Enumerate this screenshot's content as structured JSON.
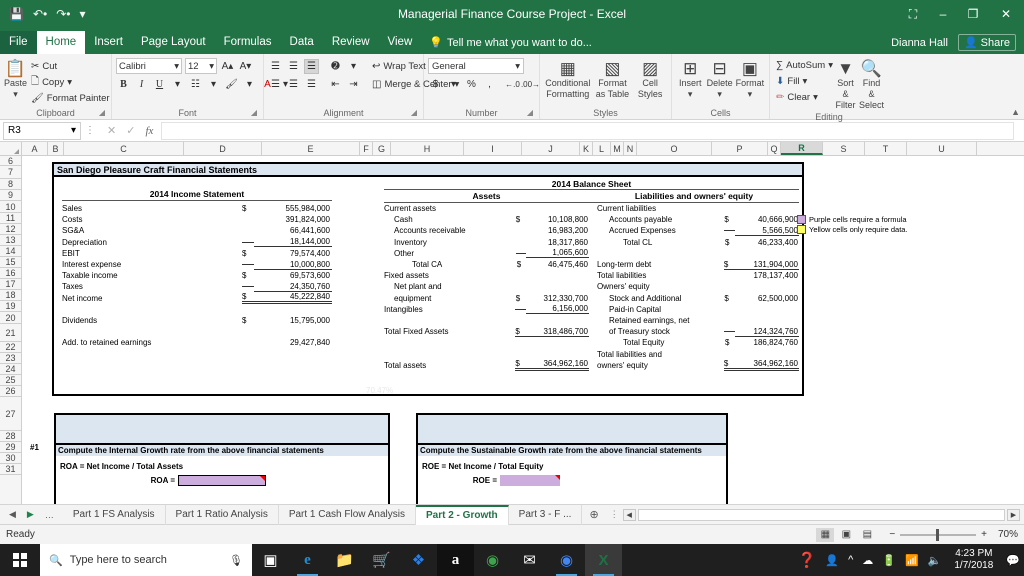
{
  "titlebar": {
    "save_icon": "save-icon",
    "undo_icon": "undo-icon",
    "redo_icon": "redo-icon",
    "qat_more_icon": "qat-dropdown-icon",
    "title": "Managerial Finance Course Project - Excel",
    "ribbon_display_icon": "ribbon-display-options-icon",
    "minimize": "–",
    "restore": "❐",
    "close": "✕"
  },
  "ribbon_tabs": [
    {
      "label": "File",
      "active": false
    },
    {
      "label": "Home",
      "active": true
    },
    {
      "label": "Insert",
      "active": false
    },
    {
      "label": "Page Layout",
      "active": false
    },
    {
      "label": "Formulas",
      "active": false
    },
    {
      "label": "Data",
      "active": false
    },
    {
      "label": "Review",
      "active": false
    },
    {
      "label": "View",
      "active": false
    }
  ],
  "tellme": "Tell me what you want to do...",
  "user": {
    "name": "Dianna Hall",
    "share_label": "Share"
  },
  "ribbon": {
    "clipboard": {
      "label": "Clipboard",
      "paste": "Paste",
      "cut": "Cut",
      "copy": "Copy",
      "format_painter": "Format Painter"
    },
    "font": {
      "label": "Font",
      "font_name": "Calibri",
      "font_size": "12",
      "grow": "A",
      "shrink": "A",
      "bold": "B",
      "italic": "I",
      "underline": "U"
    },
    "alignment": {
      "label": "Alignment",
      "wrap_text": "Wrap Text",
      "merge_center": "Merge & Center"
    },
    "number": {
      "label": "Number",
      "format": "General",
      "currency": "$",
      "percent": "%",
      "comma": ","
    },
    "styles": {
      "label": "Styles",
      "conditional_formatting": "Conditional Formatting",
      "format_as_table": "Format as Table",
      "cell_styles": "Cell Styles"
    },
    "cells": {
      "label": "Cells",
      "insert": "Insert",
      "delete": "Delete",
      "format": "Format"
    },
    "editing": {
      "label": "Editing",
      "autosum": "AutoSum",
      "fill": "Fill",
      "clear": "Clear",
      "sort_filter": "Sort & Filter",
      "find_select": "Find & Select"
    }
  },
  "formula_bar": {
    "name_box": "R3",
    "cancel_icon": "cancel-icon",
    "enter_icon": "enter-icon",
    "fx_icon": "insert-function-icon",
    "formula_value": ""
  },
  "grid": {
    "columns": [
      {
        "label": "A",
        "w": 26,
        "sel": false
      },
      {
        "label": "B",
        "w": 16,
        "sel": false
      },
      {
        "label": "C",
        "w": 120,
        "sel": false
      },
      {
        "label": "D",
        "w": 78,
        "sel": false
      },
      {
        "label": "E",
        "w": 98,
        "sel": false
      },
      {
        "label": "F",
        "w": 13,
        "sel": false
      },
      {
        "label": "G",
        "w": 18,
        "sel": false
      },
      {
        "label": "H",
        "w": 73,
        "sel": false
      },
      {
        "label": "I",
        "w": 58,
        "sel": false
      },
      {
        "label": "J",
        "w": 58,
        "sel": false
      },
      {
        "label": "K",
        "w": 13,
        "sel": false
      },
      {
        "label": "L",
        "w": 18,
        "sel": false
      },
      {
        "label": "M",
        "w": 13,
        "sel": false
      },
      {
        "label": "N",
        "w": 13,
        "sel": false
      },
      {
        "label": "O",
        "w": 75,
        "sel": false
      },
      {
        "label": "P",
        "w": 56,
        "sel": false
      },
      {
        "label": "Q",
        "w": 13,
        "sel": false
      },
      {
        "label": "R",
        "w": 42,
        "sel": true
      },
      {
        "label": "S",
        "w": 42,
        "sel": false
      },
      {
        "label": "T",
        "w": 42,
        "sel": false
      },
      {
        "label": "U",
        "w": 70,
        "sel": false
      }
    ],
    "rows": [
      {
        "label": "6",
        "h": 10
      },
      {
        "label": "7",
        "h": 13
      },
      {
        "label": "8",
        "h": 11
      },
      {
        "label": "9",
        "h": 11
      },
      {
        "label": "10",
        "h": 12
      },
      {
        "label": "11",
        "h": 11
      },
      {
        "label": "12",
        "h": 11
      },
      {
        "label": "13",
        "h": 11
      },
      {
        "label": "14",
        "h": 11
      },
      {
        "label": "15",
        "h": 11
      },
      {
        "label": "16",
        "h": 11
      },
      {
        "label": "17",
        "h": 11
      },
      {
        "label": "18",
        "h": 11
      },
      {
        "label": "19",
        "h": 11
      },
      {
        "label": "20",
        "h": 12
      },
      {
        "label": "21",
        "h": 18
      },
      {
        "label": "22",
        "h": 11
      },
      {
        "label": "23",
        "h": 11
      },
      {
        "label": "24",
        "h": 11
      },
      {
        "label": "25",
        "h": 11
      },
      {
        "label": "26",
        "h": 11
      },
      {
        "label": "27",
        "h": 34
      },
      {
        "label": "28",
        "h": 11
      },
      {
        "label": "29",
        "h": 11
      },
      {
        "label": "30",
        "h": 11
      },
      {
        "label": "31",
        "h": 11
      }
    ]
  },
  "sheet": {
    "card_title": "San Diego Pleasure Craft Financial Statements",
    "income_statement": {
      "title": "2014 Income Statement",
      "rows": [
        {
          "label": "Sales",
          "cur": "$",
          "value": "555,984,000",
          "style": ""
        },
        {
          "label": "Costs",
          "cur": "",
          "value": "391,824,000",
          "style": ""
        },
        {
          "label": "SG&A",
          "cur": "",
          "value": "66,441,600",
          "style": ""
        },
        {
          "label": "Depreciation",
          "cur": "",
          "value": "18,144,000",
          "style": "u"
        },
        {
          "label": "EBIT",
          "cur": "$",
          "value": "79,574,400",
          "style": ""
        },
        {
          "label": "Interest expense",
          "cur": "",
          "value": "10,000,800",
          "style": "u"
        },
        {
          "label": "Taxable income",
          "cur": "$",
          "value": "69,573,600",
          "style": ""
        },
        {
          "label": "Taxes",
          "cur": "",
          "value": "24,350,760",
          "style": "u"
        },
        {
          "label": "Net income",
          "cur": "$",
          "value": "45,222,840",
          "style": "dbl"
        },
        {
          "label": "",
          "cur": "",
          "value": "",
          "style": ""
        },
        {
          "label": "Dividends",
          "cur": "$",
          "value": "15,795,000",
          "style": ""
        },
        {
          "label": "",
          "cur": "",
          "value": "",
          "style": ""
        },
        {
          "label": "Add. to retained earnings",
          "cur": "",
          "value": "29,427,840",
          "style": ""
        }
      ]
    },
    "balance_sheet": {
      "title": "2014 Balance Sheet",
      "assets_header": "Assets",
      "liabilities_header": "Liabilities and owners' equity",
      "assets": [
        {
          "label": "Current assets",
          "cur": "",
          "value": "",
          "indent": 0,
          "style": ""
        },
        {
          "label": "Cash",
          "cur": "$",
          "value": "10,108,800",
          "indent": 1,
          "style": ""
        },
        {
          "label": "Accounts receivable",
          "cur": "",
          "value": "16,983,200",
          "indent": 1,
          "style": ""
        },
        {
          "label": "Inventory",
          "cur": "",
          "value": "18,317,860",
          "indent": 1,
          "style": ""
        },
        {
          "label": "Other",
          "cur": "",
          "value": "1,065,600",
          "indent": 1,
          "style": "u"
        },
        {
          "label": "Total CA",
          "cur": "$",
          "value": "46,475,460",
          "indent": 2,
          "style": ""
        },
        {
          "label": "Fixed assets",
          "cur": "",
          "value": "",
          "indent": 0,
          "style": ""
        },
        {
          "label": "Net plant and",
          "cur": "",
          "value": "",
          "indent": 1,
          "style": ""
        },
        {
          "label": "equipment",
          "cur": "$",
          "value": "312,330,700",
          "indent": 1,
          "style": ""
        },
        {
          "label": "Intangibles",
          "cur": "",
          "value": "6,156,000",
          "indent": 0,
          "style": "u"
        },
        {
          "label": "",
          "cur": "",
          "value": "",
          "indent": 0,
          "style": ""
        },
        {
          "label": "Total Fixed Assets",
          "cur": "$",
          "value": "318,486,700",
          "indent": 0,
          "style": "u"
        },
        {
          "label": "",
          "cur": "",
          "value": "",
          "indent": 0,
          "style": ""
        },
        {
          "label": "",
          "cur": "",
          "value": "",
          "indent": 0,
          "style": ""
        },
        {
          "label": "Total assets",
          "cur": "$",
          "value": "364,962,160",
          "indent": 0,
          "style": "dbl"
        }
      ],
      "liabilities": [
        {
          "label": "Current liabilities",
          "cur": "",
          "value": "",
          "indent": 1,
          "style": ""
        },
        {
          "label": "Accounts payable",
          "cur": "$",
          "value": "40,666,900",
          "indent": 2,
          "style": ""
        },
        {
          "label": "Accrued Expenses",
          "cur": "",
          "value": "5,566,500",
          "indent": 2,
          "style": "u"
        },
        {
          "label": "Total CL",
          "cur": "$",
          "value": "46,233,400",
          "indent": 3,
          "style": ""
        },
        {
          "label": "",
          "cur": "",
          "value": "",
          "indent": 0,
          "style": ""
        },
        {
          "label": "Long-term debt",
          "cur": "$",
          "value": "131,904,000",
          "indent": 1,
          "style": "u"
        },
        {
          "label": "Total liabilities",
          "cur": "",
          "value": "178,137,400",
          "indent": 1,
          "style": ""
        },
        {
          "label": "Owners' equity",
          "cur": "",
          "value": "",
          "indent": 1,
          "style": ""
        },
        {
          "label": "Stock and Additional",
          "cur": "$",
          "value": "62,500,000",
          "indent": 2,
          "style": ""
        },
        {
          "label": "Paid-in Capital",
          "cur": "",
          "value": "",
          "indent": 2,
          "style": ""
        },
        {
          "label": "Retained earnings, net",
          "cur": "",
          "value": "",
          "indent": 2,
          "style": ""
        },
        {
          "label": "of Treasury stock",
          "cur": "",
          "value": "124,324,760",
          "indent": 2,
          "style": "u"
        },
        {
          "label": "Total Equity",
          "cur": "$",
          "value": "186,824,760",
          "indent": 3,
          "style": ""
        },
        {
          "label": "Total liabilities and",
          "cur": "",
          "value": "",
          "indent": 1,
          "style": ""
        },
        {
          "label": "owners' equity",
          "cur": "$",
          "value": "364,962,160",
          "indent": 1,
          "style": "dbl"
        }
      ]
    },
    "questions": [
      {
        "number": "#1",
        "title": "Compute the Internal Growth rate from the above financial statements",
        "formula_text": "ROA = Net Income / Total Assets",
        "answer_label": "ROA =",
        "answer_value": ""
      },
      {
        "number": "",
        "title": "Compute the Sustainable Growth rate from the above financial statements",
        "formula_text": "ROE = Net Income / Total Equity",
        "answer_label": "ROE =",
        "answer_value": ""
      }
    ],
    "legend": [
      {
        "color": "#ccadde",
        "text": "Purple cells require a formula"
      },
      {
        "color": "#ffff66",
        "text": "Yellow cells only require data."
      }
    ],
    "watermark": "70.47%"
  },
  "sheet_tabs": {
    "first_icon": "first-sheet-icon",
    "prev_icon": "previous-sheet-icon",
    "overflow_icon": "sheet-overflow-icon",
    "tabs": [
      {
        "label": "Part 1 FS Analysis",
        "active": false
      },
      {
        "label": "Part 1 Ratio Analysis",
        "active": false
      },
      {
        "label": "Part 1 Cash Flow Analysis",
        "active": false
      },
      {
        "label": "Part 2 - Growth",
        "active": true
      },
      {
        "label": "Part 3 - F  ...",
        "active": false
      }
    ],
    "add_sheet": "⊕"
  },
  "status_bar": {
    "status": "Ready",
    "normal_view_icon": "normal-view-icon",
    "page_layout_icon": "page-layout-view-icon",
    "page_break_icon": "page-break-preview-icon",
    "zoom_out": "−",
    "zoom_in": "+",
    "zoom_level": "70%"
  },
  "taskbar": {
    "start_icon": "windows-start-icon",
    "search_placeholder": "Type here to search",
    "mic_icon": "microphone-icon",
    "task_view_icon": "task-view-icon",
    "apps": [
      {
        "name": "edge-icon",
        "glyph": "e"
      },
      {
        "name": "file-explorer-icon",
        "glyph": ""
      },
      {
        "name": "microsoft-store-icon",
        "glyph": ""
      },
      {
        "name": "dropbox-icon",
        "glyph": ""
      },
      {
        "name": "amazon-icon",
        "glyph": "a"
      },
      {
        "name": "tripadvisor-icon",
        "glyph": ""
      },
      {
        "name": "mail-icon",
        "glyph": "✉"
      },
      {
        "name": "chrome-icon",
        "glyph": ""
      },
      {
        "name": "excel-icon",
        "glyph": "X"
      }
    ],
    "help_icon": "help-question-icon",
    "tray": {
      "people_icon": "people-icon",
      "chevron_up_icon": "show-hidden-icons-icon",
      "onedrive_icon": "onedrive-icon",
      "battery_icon": "battery-icon",
      "wifi_icon": "wifi-icon",
      "volume_icon": "volume-icon",
      "time": "4:23 PM",
      "date": "1/7/2018",
      "action_center_icon": "action-center-icon"
    }
  }
}
